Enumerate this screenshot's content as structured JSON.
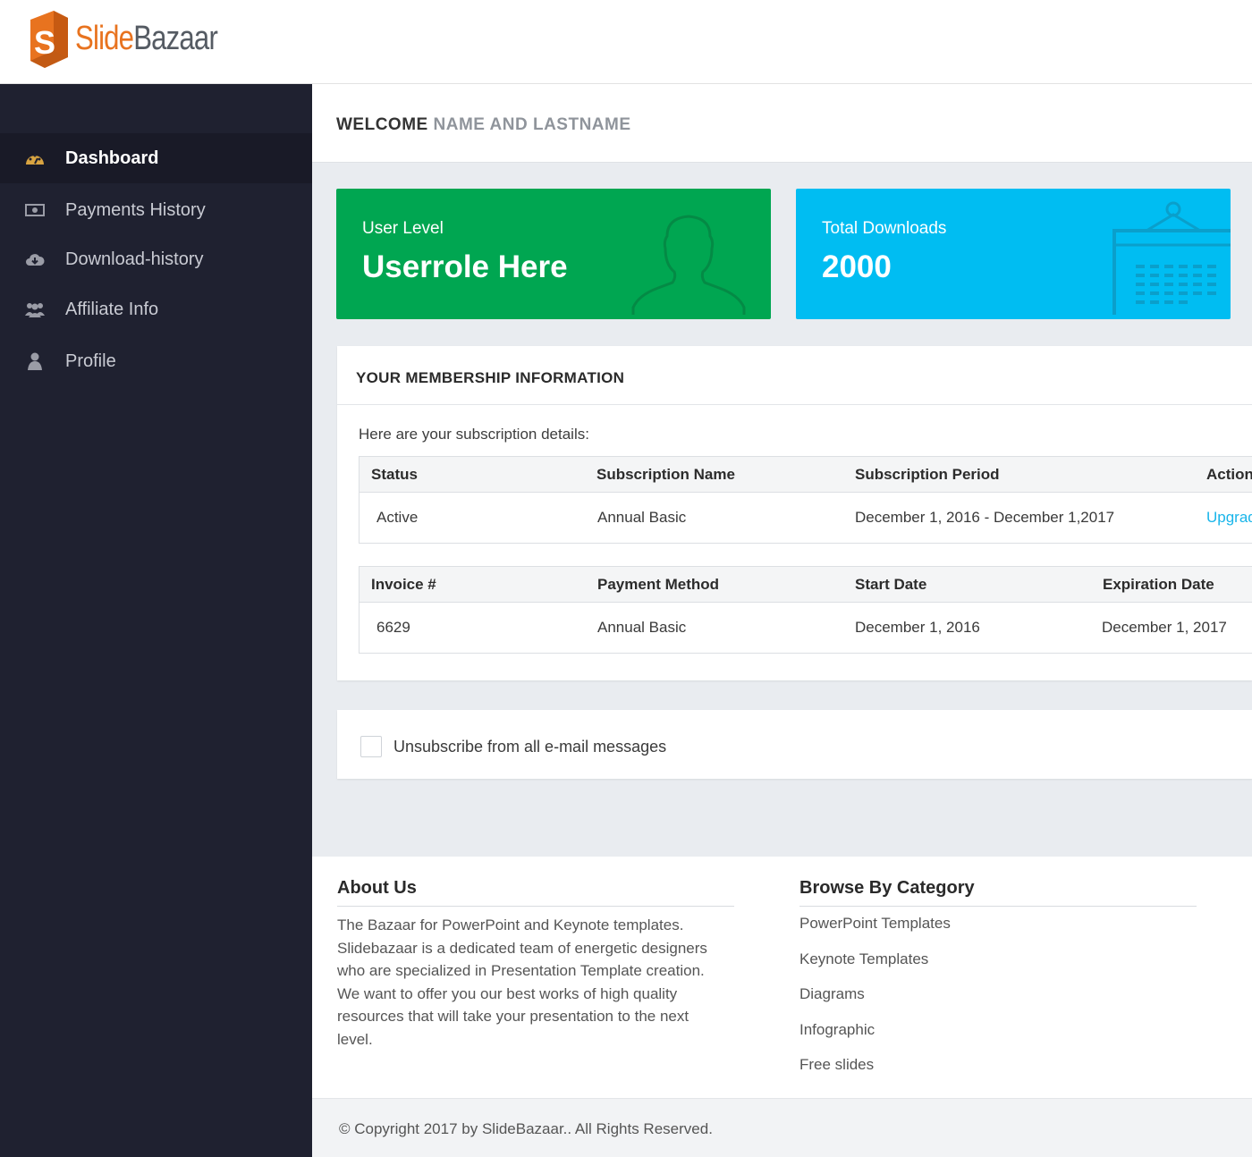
{
  "brand": {
    "logo_letter": "S",
    "name_part1": "Slide",
    "name_part2": "Bazaar",
    "colors": {
      "orange": "#e8731f",
      "gray": "#555b63"
    }
  },
  "sidebar": {
    "items": [
      {
        "label": "Dashboard",
        "icon": "dashboard-gauge-icon",
        "active": true
      },
      {
        "label": "Payments History",
        "icon": "money-icon",
        "active": false
      },
      {
        "label": "Download-history",
        "icon": "cloud-download-icon",
        "active": false
      },
      {
        "label": "Affiliate Info",
        "icon": "users-icon",
        "active": false
      },
      {
        "label": "Profile",
        "icon": "user-icon",
        "active": false
      }
    ]
  },
  "welcome": {
    "prefix": "WELCOME",
    "name": "NAME AND LASTNAME"
  },
  "cards": {
    "user_level": {
      "label": "User Level",
      "value": "Userrole Here",
      "color": "#00a651",
      "icon": "person-silhouette-icon"
    },
    "downloads": {
      "label": "Total Downloads",
      "value": "2000",
      "color": "#00bdf2",
      "icon": "calendar-icon"
    }
  },
  "membership": {
    "title": "YOUR MEMBERSHIP INFORMATION",
    "intro": "Here are your subscription details:",
    "subscription_table": {
      "headers": [
        "Status",
        "Subscription Name",
        "Subscription Period",
        "Action"
      ],
      "row": [
        "Active",
        "Annual Basic",
        "December 1, 2016 - December 1,2017",
        "Upgrade"
      ]
    },
    "invoice_table": {
      "headers": [
        "Invoice #",
        "Payment Method",
        "Start Date",
        "Expiration Date"
      ],
      "row": [
        "6629",
        "Annual Basic",
        "December 1, 2016",
        "December 1, 2017"
      ]
    }
  },
  "unsubscribe": {
    "label": "Unsubscribe from all e-mail messages",
    "checked": false
  },
  "footer": {
    "about": {
      "title": "About Us",
      "text": "The Bazaar for PowerPoint and Keynote templates. Slidebazaar is a dedicated team of energetic designers who are specialized in Presentation Template creation. We want to offer you our best works of high quality resources that will take your presentation to the next level."
    },
    "categories": {
      "title": "Browse By Category",
      "links": [
        "PowerPoint Templates",
        "Keynote Templates",
        "Diagrams",
        "Infographic",
        "Free slides"
      ]
    },
    "copyright": "© Copyright 2017 by SlideBazaar.. All Rights Reserved."
  }
}
